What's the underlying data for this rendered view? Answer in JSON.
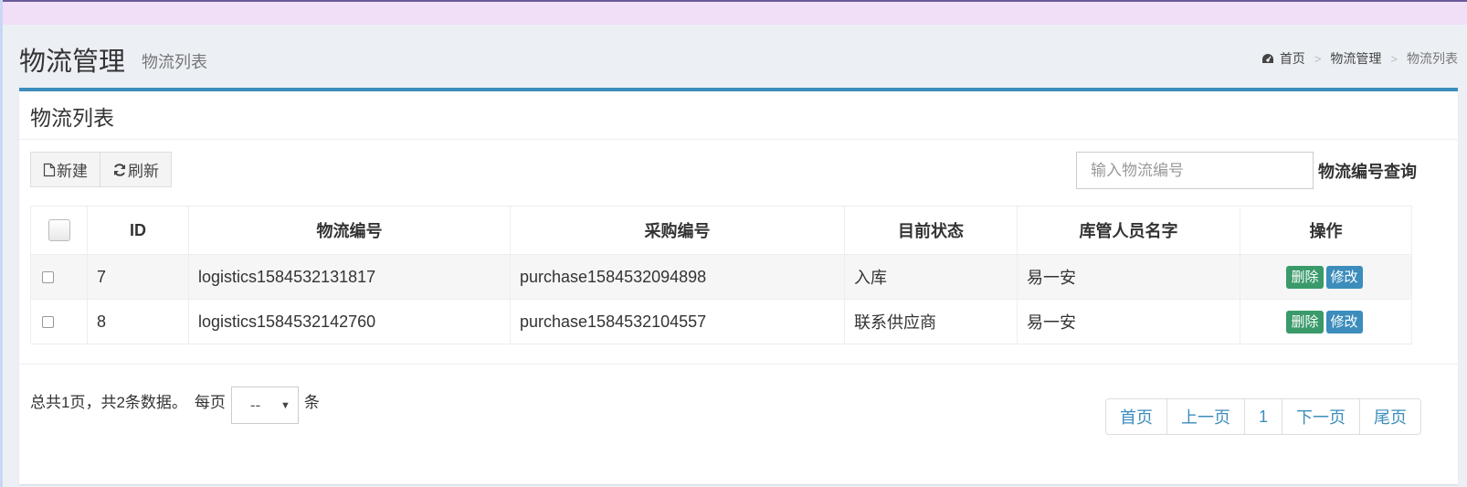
{
  "header": {
    "title": "物流管理",
    "subtitle": "物流列表",
    "breadcrumb": [
      "首页",
      "物流管理",
      "物流列表"
    ]
  },
  "box": {
    "title": "物流列表",
    "toolbar": {
      "new_label": "新建",
      "refresh_label": "刷新"
    },
    "search": {
      "placeholder": "输入物流编号",
      "button_label": "物流编号查询"
    }
  },
  "table": {
    "headers": [
      "ID",
      "物流编号",
      "采购编号",
      "目前状态",
      "库管人员名字",
      "操作"
    ],
    "rows": [
      {
        "id": "7",
        "logistics_no": "logistics1584532131817",
        "purchase_no": "purchase1584532094898",
        "status": "入库",
        "keeper": "易一安"
      },
      {
        "id": "8",
        "logistics_no": "logistics1584532142760",
        "purchase_no": "purchase1584532104557",
        "status": "联系供应商",
        "keeper": "易一安"
      }
    ],
    "actions": {
      "delete_label": "删除",
      "edit_label": "修改"
    }
  },
  "footer": {
    "summary": "总共1页，共2条数据。",
    "per_page_label": "每页",
    "per_page_value": "--",
    "unit_label": "条"
  },
  "pagination": [
    "首页",
    "上一页",
    "1",
    "下一页",
    "尾页"
  ],
  "colors": {
    "accent": "#3c8dbc",
    "delete": "#3a9a6a",
    "edit": "#3c8dbc"
  }
}
